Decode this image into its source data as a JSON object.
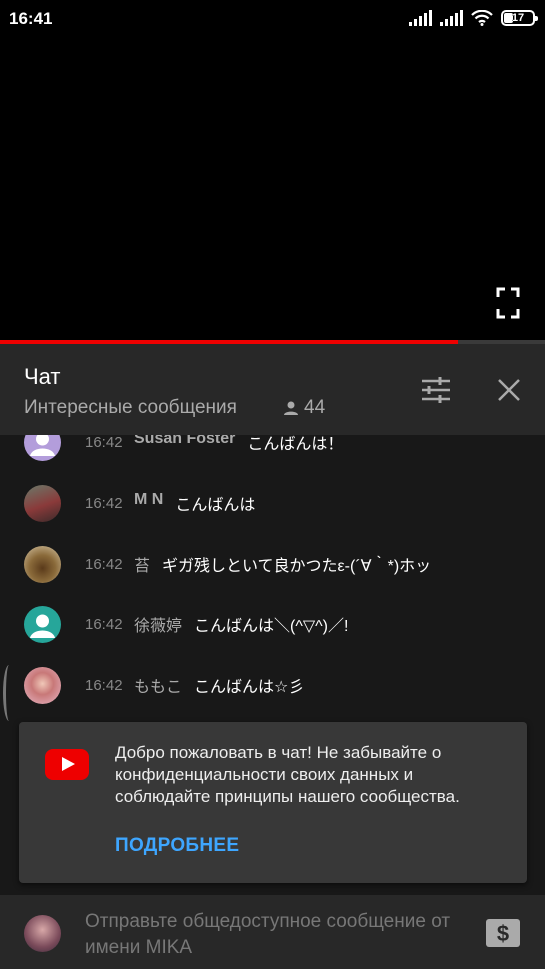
{
  "status_bar": {
    "time": "16:41",
    "battery": "17",
    "icons": [
      "signal-icon",
      "signal-icon",
      "wifi-icon",
      "battery-icon"
    ]
  },
  "video": {
    "progress_fraction": 0.84
  },
  "chat_header": {
    "title": "Чат",
    "subtitle": "Интересные сообщения",
    "viewer_count": "44"
  },
  "messages": [
    {
      "time": "16:42",
      "author": "Susan Foster",
      "text": "こんばんは！",
      "author_bold": true,
      "avatar": "default-avatar"
    },
    {
      "time": "16:42",
      "author": "M N",
      "text": "こんばんは",
      "author_bold": true,
      "avatar": "photo-avatar"
    },
    {
      "time": "16:42",
      "author": "苔",
      "text": "ギガ残しといて良かつたε-(´∀｀*)ホッ",
      "author_bold": false,
      "avatar": "photo-avatar"
    },
    {
      "time": "16:42",
      "author": "徐薇婷",
      "text": "こんばんは＼(^▽^)／!",
      "author_bold": false,
      "avatar": "default-avatar"
    },
    {
      "time": "16:42",
      "author": "ももこ",
      "text": "こんばんは☆彡",
      "author_bold": false,
      "avatar": "photo-avatar"
    }
  ],
  "welcome": {
    "text": "Добро пожаловать в чат! Не забывайте о конфиденциальности своих данных и соблюдайте принципы нашего сообщества.",
    "learn_more": "ПОДРОБНЕЕ"
  },
  "input": {
    "placeholder": "Отправьте общедоступное сообщение от имени MIKA"
  },
  "colors": {
    "accent_red": "#ff0000",
    "link_blue": "#3ea6ff",
    "header_bg": "#282828",
    "chat_bg": "#181818"
  }
}
